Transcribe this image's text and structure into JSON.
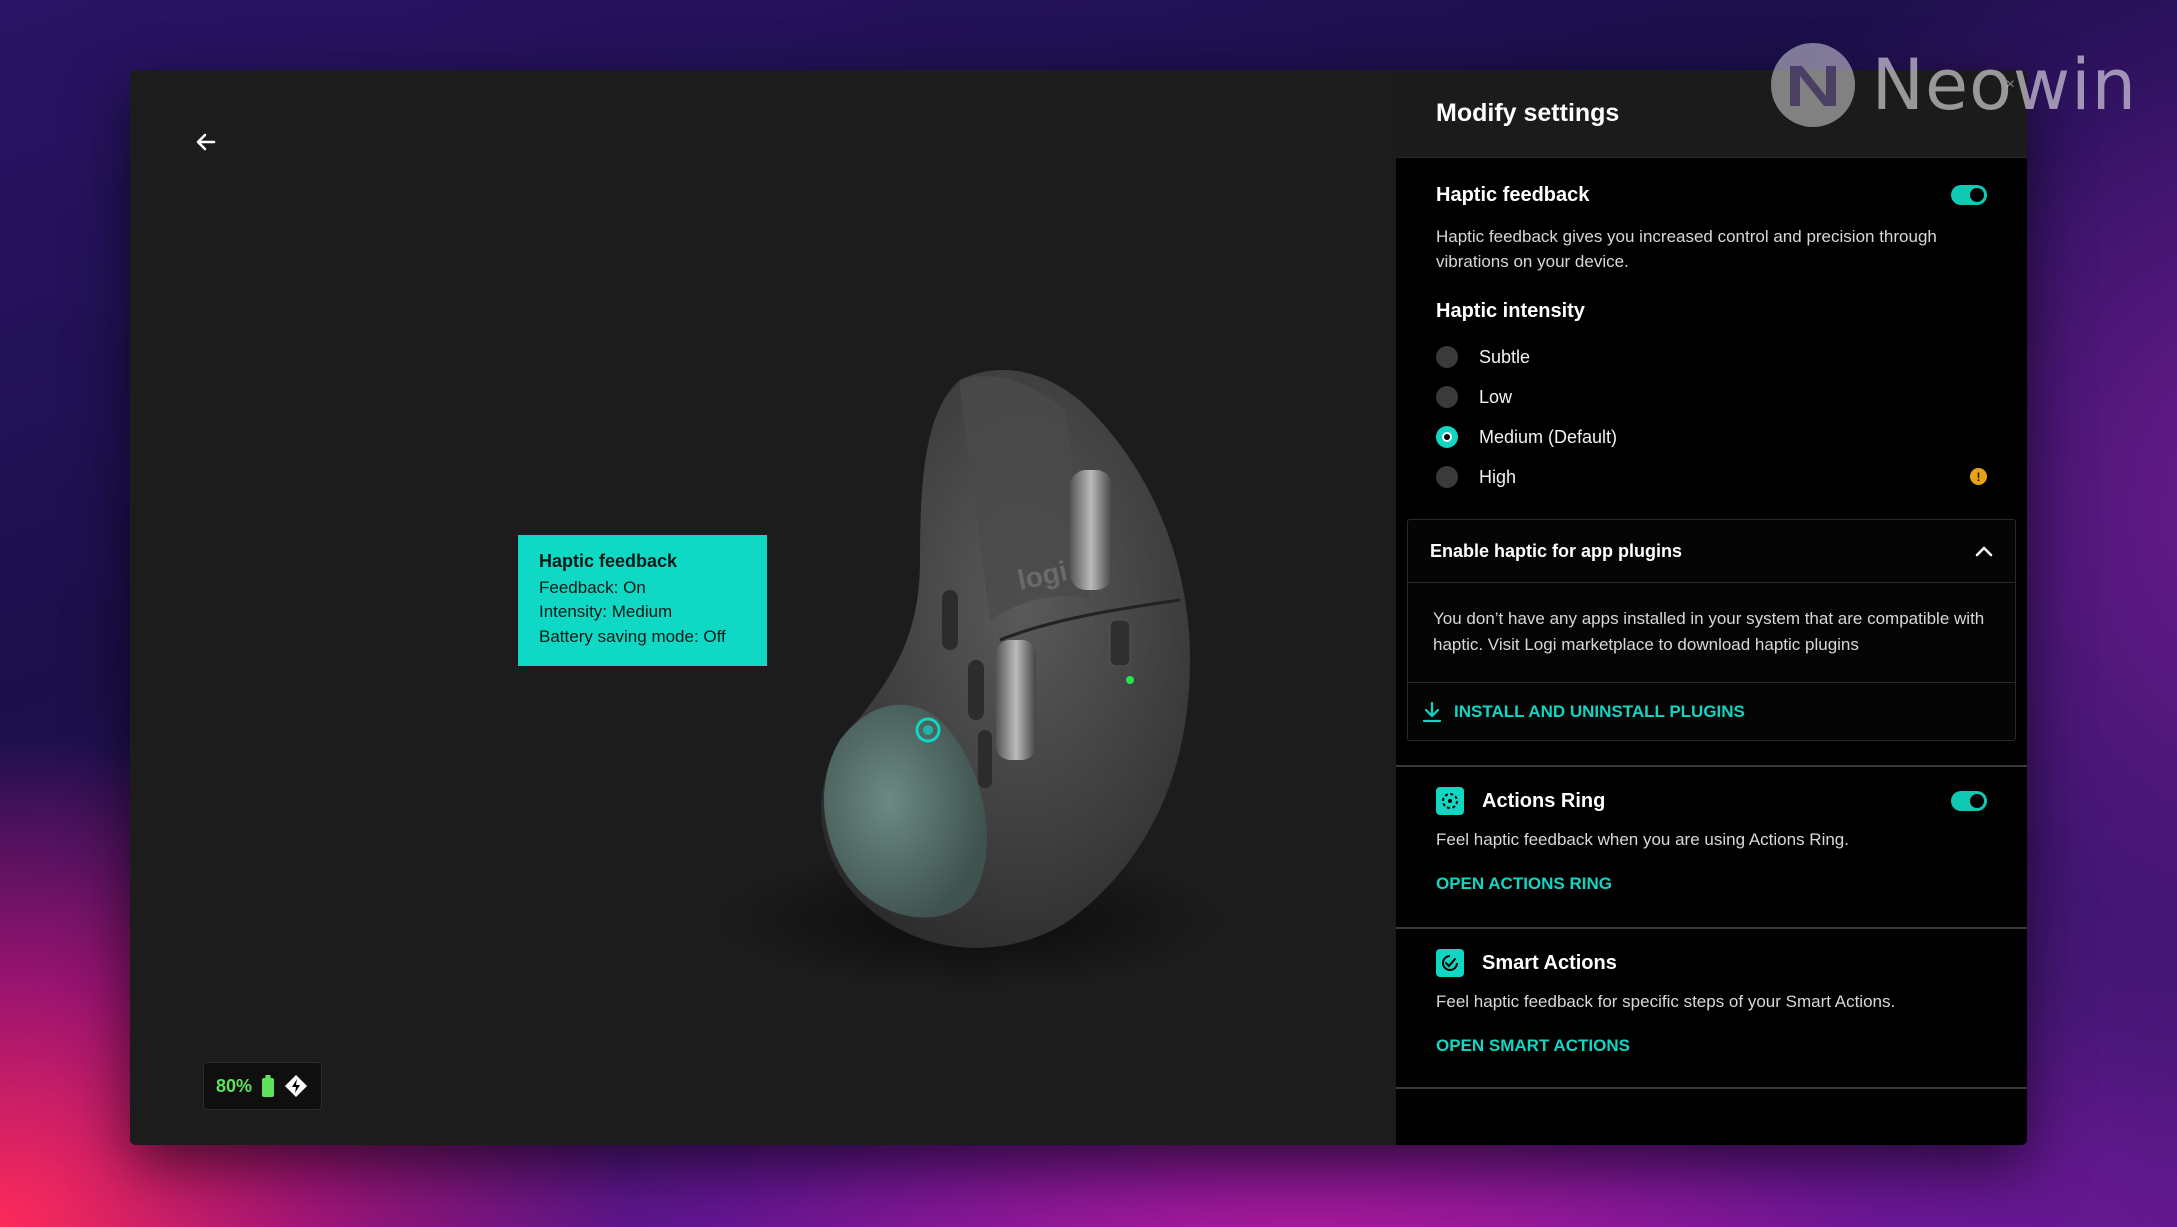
{
  "watermark": {
    "text": "Neowin"
  },
  "stage": {
    "callout": {
      "title": "Haptic feedback",
      "lines": [
        "Feedback: On",
        "Intensity: Medium",
        "Battery saving mode: Off"
      ]
    },
    "device_logo": "logi",
    "battery": {
      "percent": "80%"
    }
  },
  "panel": {
    "title": "Modify settings",
    "close_label": "×",
    "haptic": {
      "label": "Haptic feedback",
      "enabled": true,
      "description": "Haptic feedback gives you increased control and precision through vibrations on your device."
    },
    "intensity": {
      "label": "Haptic intensity",
      "options": [
        "Subtle",
        "Low",
        "Medium (Default)",
        "High"
      ],
      "selected": "Medium (Default)",
      "warning_option": "High",
      "warning_glyph": "!"
    },
    "plugins": {
      "title": "Enable haptic for app plugins",
      "expanded": true,
      "message": "You don’t have any apps installed in your system that are compatible with haptic. Visit Logi marketplace to download haptic plugins",
      "link": "INSTALL AND UNINSTALL PLUGINS"
    },
    "actions_ring": {
      "label": "Actions Ring",
      "enabled": true,
      "description": "Feel haptic feedback when you are using Actions Ring.",
      "link": "OPEN ACTIONS RING"
    },
    "smart_actions": {
      "label": "Smart Actions",
      "description": "Feel haptic feedback for specific steps of your Smart Actions.",
      "link": "OPEN SMART ACTIONS"
    }
  },
  "colors": {
    "accent": "#10d6c2",
    "callout_bg": "#0fd9c4",
    "battery_text": "#5fe35f",
    "warning": "#e8a21a"
  },
  "icons": {
    "back": "arrow-left-icon",
    "battery": "battery-icon",
    "connection": "logi-bolt-icon",
    "collapse": "chevron-up-icon",
    "download": "download-icon",
    "actions_ring": "actions-ring-icon",
    "smart_actions": "smart-actions-icon"
  }
}
